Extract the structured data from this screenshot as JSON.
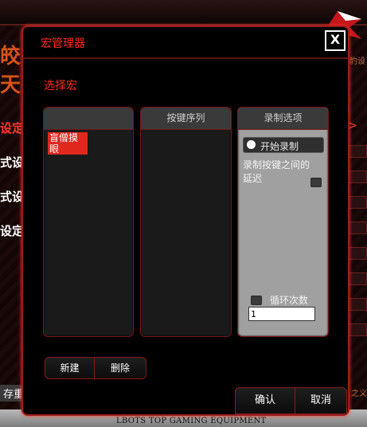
{
  "background": {
    "left_big_1": "皎",
    "left_big_2": "天",
    "left_menu": [
      "设定",
      "式设",
      "式设",
      "设定"
    ],
    "right_link": "豹设",
    "bottom_left": "存重置",
    "bottom_right": "之义",
    "footer": "LBOTS TOP GAMING EQUIPMENT",
    "accent_color": "#ff2a1a"
  },
  "dialog": {
    "title": "宏管理器",
    "close": "X",
    "select_label": "选择宏",
    "columns": {
      "macros_header": "",
      "sequence_header": "按键序列",
      "options_header": "录制选项"
    },
    "macros": [
      "盲僧摸眼"
    ],
    "options": {
      "record_button": "开始录制",
      "delay_label_line1": "录制按键之间的",
      "delay_label_line2": "延迟",
      "loop_label": "循环次数",
      "loop_value": "1"
    },
    "buttons": {
      "new": "新建",
      "delete": "删除",
      "confirm": "确认",
      "cancel": "取消"
    }
  }
}
